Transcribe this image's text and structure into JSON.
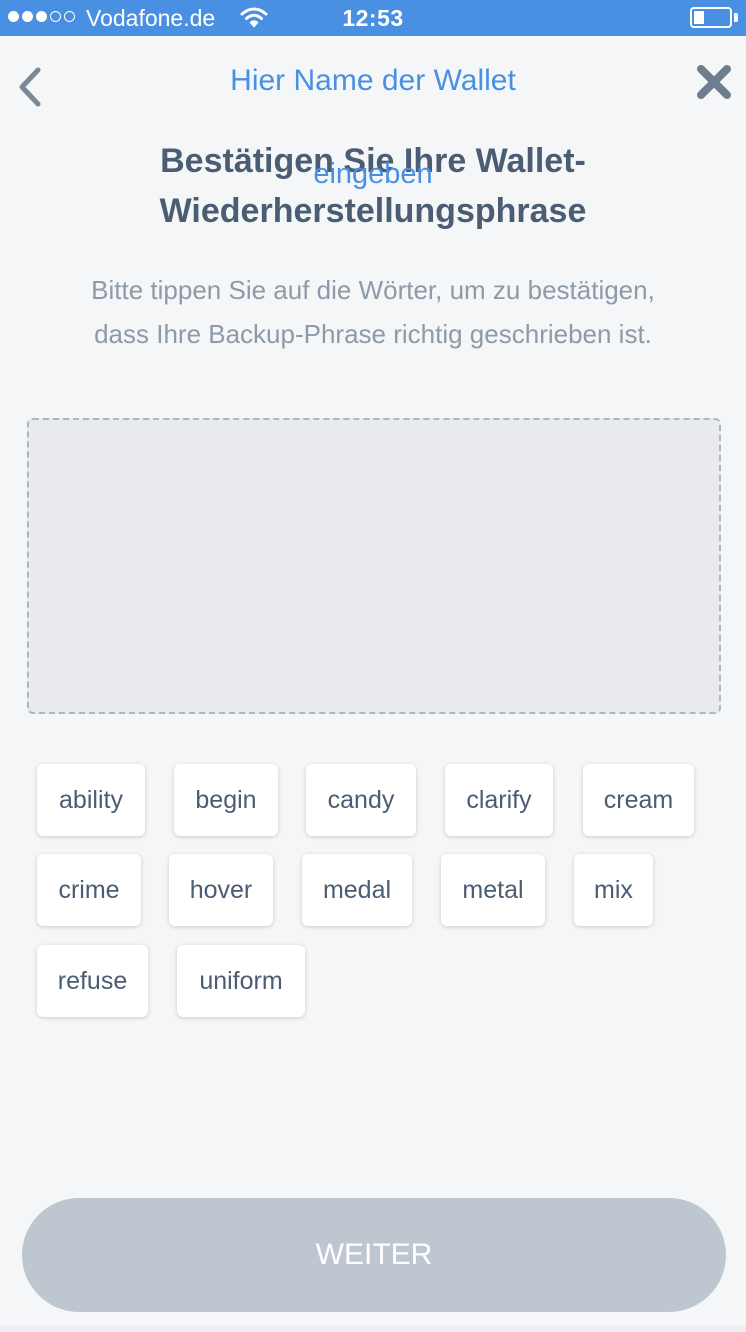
{
  "status_bar": {
    "carrier": "Vodafone.de",
    "time": "12:53",
    "signal_filled": 3,
    "signal_total": 5,
    "battery_level": 0.3
  },
  "header": {
    "wallet_name_line1": "Hier Name der Wallet",
    "wallet_name_line2": "eingeben",
    "back_icon": "chevron-left-icon",
    "close_icon": "close-icon"
  },
  "main": {
    "title_line1": "Bestätigen Sie Ihre Wallet-",
    "title_line2": "Wiederherstellungsphrase",
    "instructions_line1": "Bitte tippen Sie auf die Wörter, um zu bestätigen,",
    "instructions_line2": "dass Ihre Backup-Phrase richtig geschrieben ist."
  },
  "words": [
    "ability",
    "begin",
    "candy",
    "clarify",
    "cream",
    "crime",
    "hover",
    "medal",
    "metal",
    "mix",
    "refuse",
    "uniform"
  ],
  "footer": {
    "continue_label": "WEITER"
  },
  "colors": {
    "accent": "#4a90e2",
    "title_text": "#4a5d73",
    "muted_text": "#8d9aa8",
    "button_disabled": "#bec7cf"
  }
}
